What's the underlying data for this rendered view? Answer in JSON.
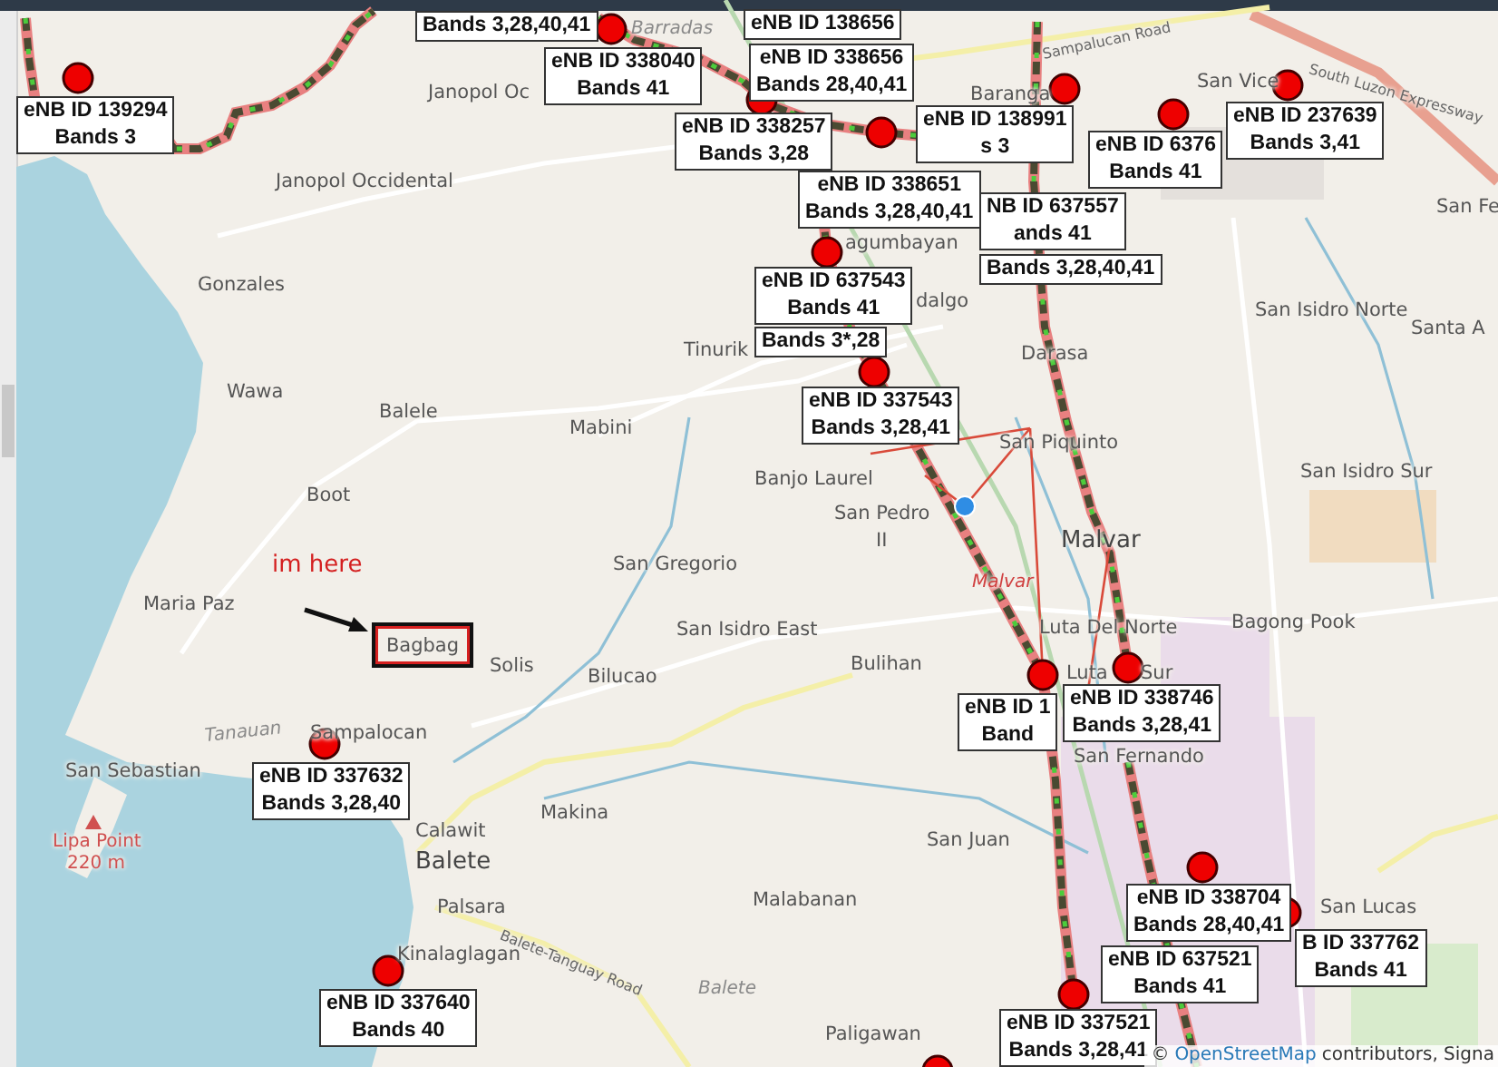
{
  "places": [
    {
      "name": "Barradas",
      "kind": "water"
    },
    {
      "name": "Janopol Oc",
      "kind": "place"
    },
    {
      "name": "Janopol Occidental",
      "kind": "place"
    },
    {
      "name": "Gonzales",
      "kind": "place"
    },
    {
      "name": "Tinurik",
      "kind": "place"
    },
    {
      "name": "Wawa",
      "kind": "place"
    },
    {
      "name": "Balele",
      "kind": "place"
    },
    {
      "name": "Mabini",
      "kind": "place"
    },
    {
      "name": "Boot",
      "kind": "place"
    },
    {
      "name": "Banjo Laurel",
      "kind": "place"
    },
    {
      "name": "San Pedro",
      "kind": "place"
    },
    {
      "name": "II",
      "kind": "place"
    },
    {
      "name": "San Gregorio",
      "kind": "place"
    },
    {
      "name": "Maria Paz",
      "kind": "place"
    },
    {
      "name": "Solis",
      "kind": "place"
    },
    {
      "name": "San Isidro East",
      "kind": "place"
    },
    {
      "name": "Bilucao",
      "kind": "place"
    },
    {
      "name": "Bulihan",
      "kind": "place"
    },
    {
      "name": "Malvar",
      "kind": "town"
    },
    {
      "name": "Malvar",
      "kind": "rail"
    },
    {
      "name": "Luta Del Norte",
      "kind": "place"
    },
    {
      "name": "Luta",
      "kind": "place"
    },
    {
      "name": "Sur",
      "kind": "place"
    },
    {
      "name": "San Isidro Sur",
      "kind": "place"
    },
    {
      "name": "Bagong Pook",
      "kind": "place"
    },
    {
      "name": "Darasa",
      "kind": "place"
    },
    {
      "name": "San Piquinto",
      "kind": "place"
    },
    {
      "name": "agumbayan",
      "kind": "place"
    },
    {
      "name": "dalgo",
      "kind": "place"
    },
    {
      "name": "San Isidro Norte",
      "kind": "place"
    },
    {
      "name": "Santa A",
      "kind": "place"
    },
    {
      "name": "San Fe",
      "kind": "place"
    },
    {
      "name": "San Vice",
      "kind": "place"
    },
    {
      "name": "Baranga",
      "kind": "place"
    },
    {
      "name": "San Fernando",
      "kind": "place"
    },
    {
      "name": "San Juan",
      "kind": "place"
    },
    {
      "name": "Malabanan",
      "kind": "place"
    },
    {
      "name": "Paligawan",
      "kind": "place"
    },
    {
      "name": "San Lucas",
      "kind": "place"
    },
    {
      "name": "Sampalocan",
      "kind": "place"
    },
    {
      "name": "Tanauan",
      "kind": "water"
    },
    {
      "name": "San Sebastian",
      "kind": "place"
    },
    {
      "name": "Lipa Point",
      "kind": "peak"
    },
    {
      "name": "220 m",
      "kind": "elevation"
    },
    {
      "name": "Calawit",
      "kind": "place"
    },
    {
      "name": "Makina",
      "kind": "place"
    },
    {
      "name": "Balete",
      "kind": "town"
    },
    {
      "name": "Palsara",
      "kind": "place"
    },
    {
      "name": "Kinalaglagan",
      "kind": "place"
    },
    {
      "name": "Balete",
      "kind": "water"
    },
    {
      "name": "Sampalucan Road",
      "kind": "road"
    },
    {
      "name": "South Luzon Expressway",
      "kind": "road"
    },
    {
      "name": "Balete-Tanguay Road",
      "kind": "road"
    }
  ],
  "highlighted_place": {
    "name": "Bagbag"
  },
  "note": {
    "text": "im here"
  },
  "cell_sites": [
    {
      "lines": [
        "Bands 3,28,40,41"
      ]
    },
    {
      "lines": [
        "eNB ID 338040",
        "Bands 41"
      ]
    },
    {
      "lines": [
        "eNB ID 138656"
      ]
    },
    {
      "lines": [
        "eNB ID 338656",
        "Bands 28,40,41"
      ]
    },
    {
      "lines": [
        "eNB ID 139294",
        "Bands 3"
      ]
    },
    {
      "lines": [
        "eNB ID 338257",
        "Bands 3,28"
      ]
    },
    {
      "lines": [
        "eNB ID 338651",
        "Bands 3,28,40,41"
      ]
    },
    {
      "lines": [
        "eNB ID 138991",
        "s 3"
      ]
    },
    {
      "lines": [
        "NB ID 637557",
        "ands 41"
      ]
    },
    {
      "lines": [
        "Bands 3,28,40,41"
      ]
    },
    {
      "lines": [
        "eNB ID 6376",
        "Bands 41"
      ]
    },
    {
      "lines": [
        "eNB ID 237639",
        "Bands 3,41"
      ]
    },
    {
      "lines": [
        "eNB ID 637543",
        "Bands 41"
      ]
    },
    {
      "lines": [
        "Bands 3*,28"
      ]
    },
    {
      "lines": [
        "eNB ID 337543",
        "Bands 3,28,41"
      ]
    },
    {
      "lines": [
        "eNB ID 337632",
        "Bands 3,28,40"
      ]
    },
    {
      "lines": [
        "eNB ID 1",
        "Band"
      ]
    },
    {
      "lines": [
        "eNB ID 338746",
        "Bands 3,28,41"
      ]
    },
    {
      "lines": [
        "eNB ID 337640",
        "Bands 40"
      ]
    },
    {
      "lines": [
        "eNB ID 338704",
        "Bands 28,40,41"
      ]
    },
    {
      "lines": [
        "B ID 337762",
        "Bands 41"
      ]
    },
    {
      "lines": [
        "eNB ID 637521",
        "Bands 41"
      ]
    },
    {
      "lines": [
        "eNB ID 337521",
        "Bands 3,28,41"
      ]
    }
  ],
  "attribution": {
    "symbol": "©",
    "link": "OpenStreetMap",
    "text": "contributors, Signa"
  }
}
